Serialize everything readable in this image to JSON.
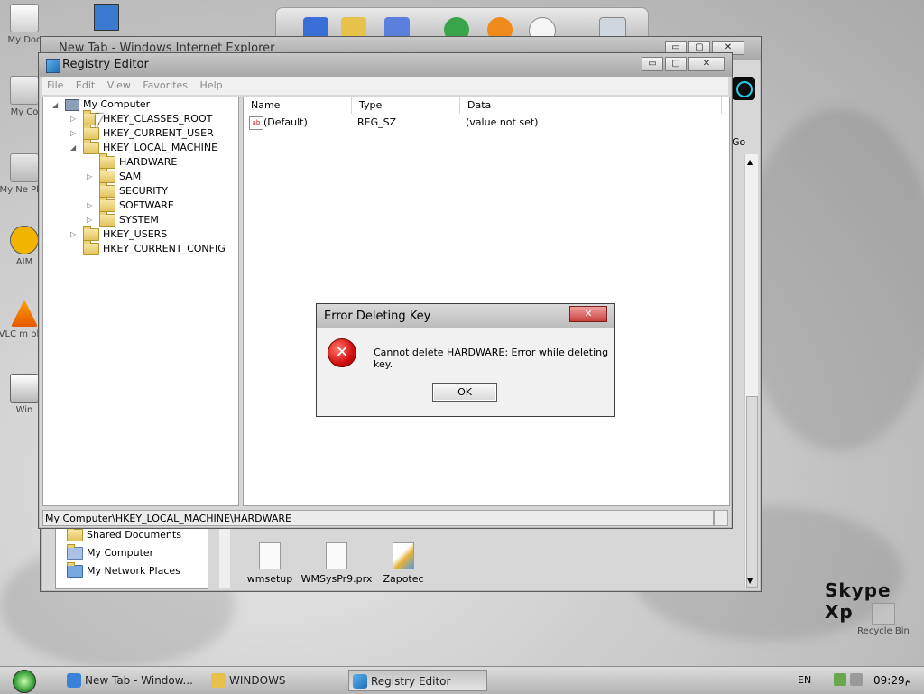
{
  "desktop": {
    "icons": [
      {
        "label": "My Doc"
      },
      {
        "label": "My Co"
      },
      {
        "label": "My Ne Plac"
      },
      {
        "label": "AIM"
      },
      {
        "label": "VLC m play"
      },
      {
        "label": "Win"
      }
    ],
    "recycle_bin": "Recycle Bin",
    "skype_label": "Skype Xp"
  },
  "ie_window": {
    "title": "New Tab - Windows Internet Explorer",
    "go_label": "Go"
  },
  "explorer_bg": {
    "side_links": [
      "Shared Documents",
      "My Computer",
      "My Network Places"
    ],
    "files": [
      "wmsetup",
      "WMSysPr9.prx",
      "Zapotec"
    ]
  },
  "regedit": {
    "title": "Registry Editor",
    "menu": [
      "File",
      "Edit",
      "View",
      "Favorites",
      "Help"
    ],
    "tree": [
      {
        "label": "My Computer",
        "level": 0,
        "expander": "◢"
      },
      {
        "label": "HKEY_CLASSES_ROOT",
        "level": 1,
        "expander": "▷"
      },
      {
        "label": "HKEY_CURRENT_USER",
        "level": 1,
        "expander": "▷"
      },
      {
        "label": "HKEY_LOCAL_MACHINE",
        "level": 1,
        "expander": "◢"
      },
      {
        "label": "HARDWARE",
        "level": 2,
        "expander": ""
      },
      {
        "label": "SAM",
        "level": 2,
        "expander": "▷"
      },
      {
        "label": "SECURITY",
        "level": 2,
        "expander": ""
      },
      {
        "label": "SOFTWARE",
        "level": 2,
        "expander": "▷"
      },
      {
        "label": "SYSTEM",
        "level": 2,
        "expander": "▷"
      },
      {
        "label": "HKEY_USERS",
        "level": 1,
        "expander": "▷"
      },
      {
        "label": "HKEY_CURRENT_CONFIG",
        "level": 1,
        "expander": ""
      }
    ],
    "columns": [
      "Name",
      "Type",
      "Data"
    ],
    "values": [
      {
        "name": "(Default)",
        "type": "REG_SZ",
        "data": "(value not set)"
      }
    ],
    "status_path": "My Computer\\HKEY_LOCAL_MACHINE\\HARDWARE"
  },
  "dialog": {
    "title": "Error Deleting Key",
    "message": "Cannot delete HARDWARE:  Error while deleting key.",
    "ok_label": "OK",
    "close_glyph": "✕"
  },
  "taskbar": {
    "items": [
      "New Tab - Window...",
      "WINDOWS",
      "Registry Editor"
    ],
    "language": "EN",
    "clock": "09:29",
    "clock_suffix": "م"
  },
  "window_controls": {
    "minimize": "▭",
    "maximize": "▢",
    "close": "✕"
  }
}
